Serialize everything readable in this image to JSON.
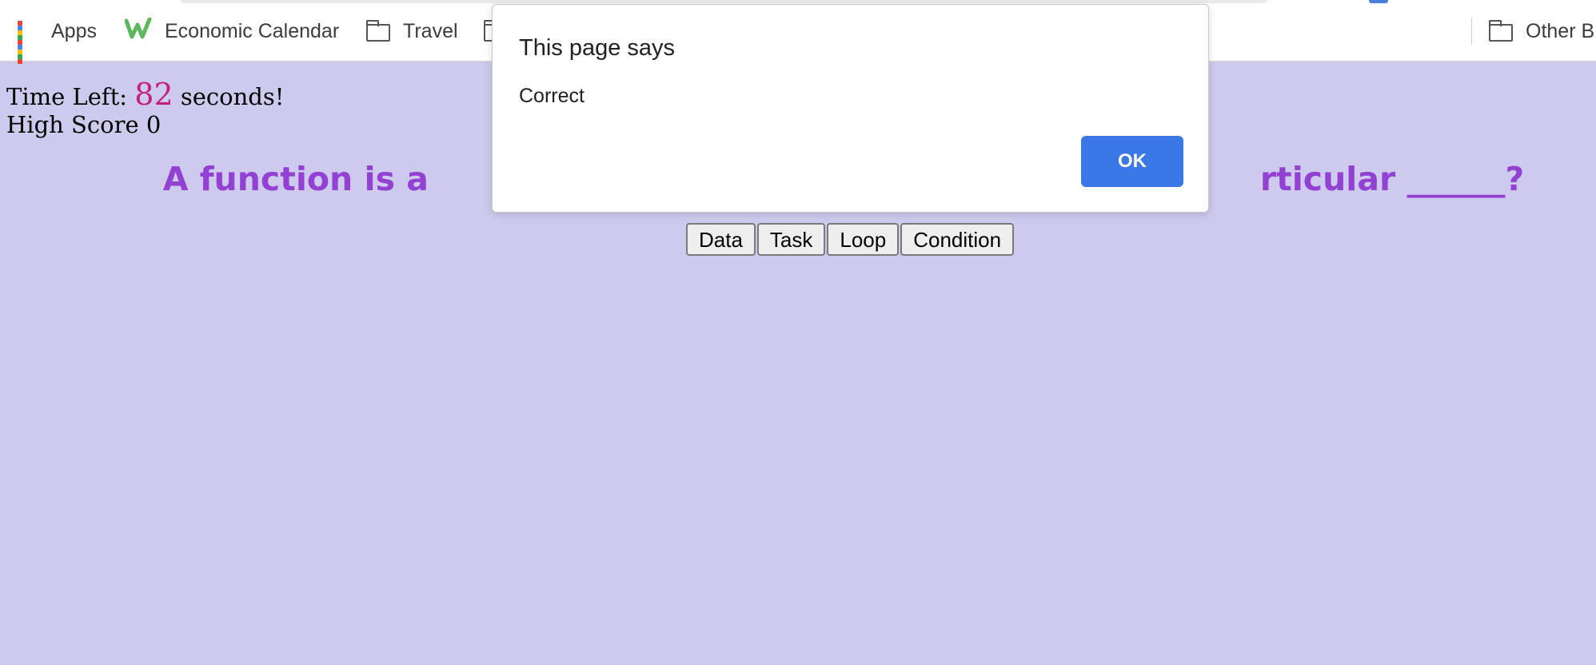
{
  "bookmarks": {
    "apps_label": "Apps",
    "items": [
      {
        "label": "Economic Calendar",
        "icon": "economic-calendar-icon"
      },
      {
        "label": "Travel",
        "icon": "folder-icon"
      }
    ],
    "other_label": "Other B"
  },
  "game": {
    "time_left_prefix": "Time Left: ",
    "time_left_value": "82",
    "time_left_suffix": " seconds!",
    "high_score_label": "High Score 0",
    "question_left": "A function is a",
    "question_right": "rticular ______?",
    "answers": [
      "Data",
      "Task",
      "Loop",
      "Condition"
    ]
  },
  "dialog": {
    "title": "This page says",
    "message": "Correct",
    "ok_label": "OK"
  },
  "colors": {
    "page_background": "#cdcaed",
    "question_text": "#9341d2",
    "timer_number": "#c2217b",
    "ok_button": "#3b78e7"
  }
}
